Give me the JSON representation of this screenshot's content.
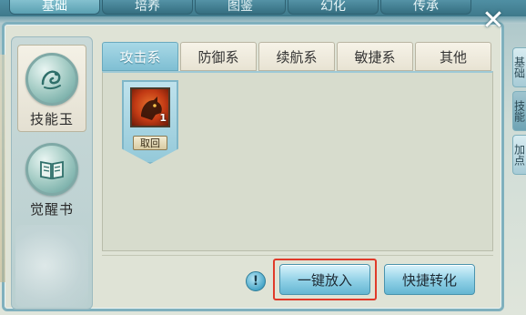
{
  "top_tabs": [
    {
      "label": "基础",
      "active": true
    },
    {
      "label": "培养",
      "active": false
    },
    {
      "label": "图鉴",
      "active": false
    },
    {
      "label": "幻化",
      "active": false
    },
    {
      "label": "传承",
      "active": false
    }
  ],
  "close_icon": "close-icon",
  "side_menu": [
    {
      "label": "技能玉",
      "icon": "jade-orb-icon",
      "active": true
    },
    {
      "label": "觉醒书",
      "icon": "book-orb-icon",
      "active": false
    }
  ],
  "category_tabs": [
    {
      "label": "攻击系",
      "active": true
    },
    {
      "label": "防御系",
      "active": false
    },
    {
      "label": "续航系",
      "active": false
    },
    {
      "label": "敏捷系",
      "active": false
    },
    {
      "label": "其他",
      "active": false
    }
  ],
  "skill_slot": {
    "level": "1",
    "remove_label": "取回",
    "icon": "beast-skill-icon"
  },
  "hint": "!",
  "buttons": {
    "put_all": "一键放入",
    "quick_convert": "快捷转化"
  },
  "right_tabs": [
    "基础",
    "技能",
    "加点"
  ],
  "colors": {
    "accent": "#7fbfd3",
    "highlight": "#e03a2a",
    "panel": "#d7dccd"
  }
}
